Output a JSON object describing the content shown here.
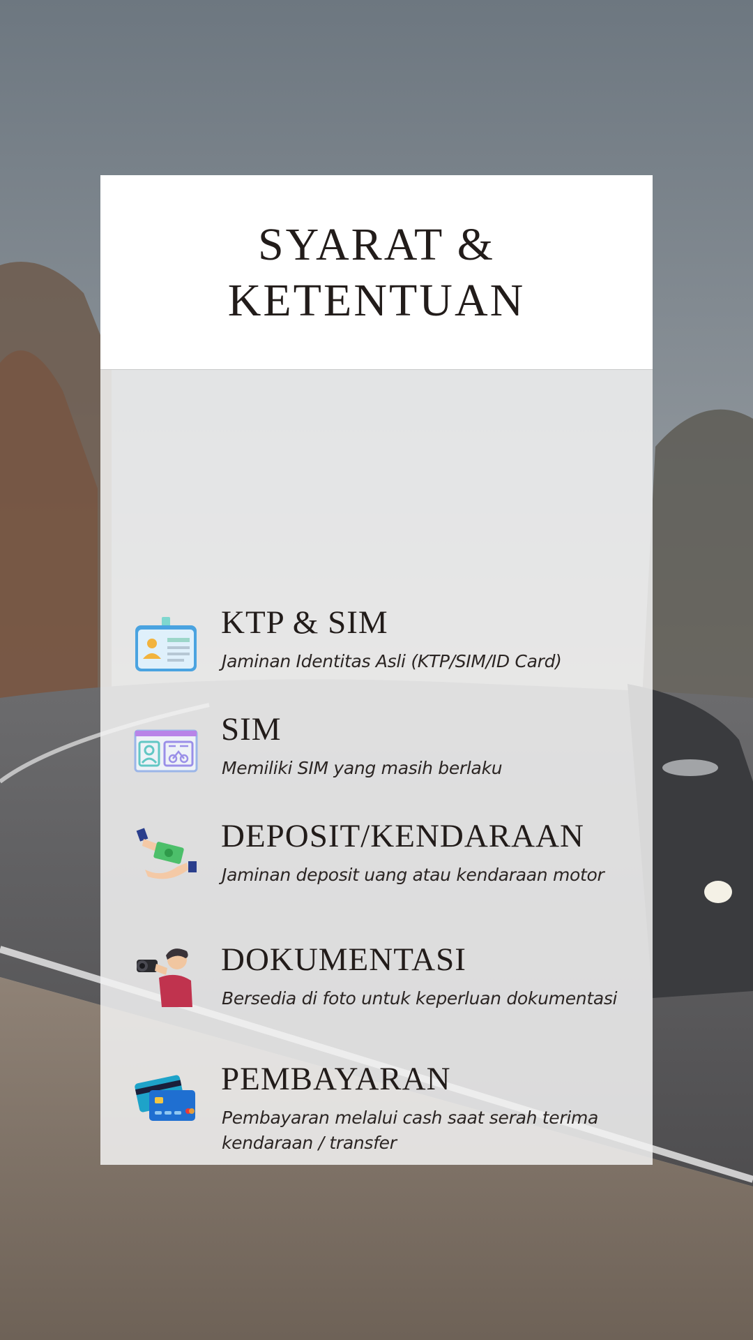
{
  "title_lines": [
    "SYARAT &",
    "KETENTUAN"
  ],
  "items": [
    {
      "icon": "id-card-icon",
      "heading": "KTP & SIM",
      "desc": "Jaminan Identitas Asli (KTP/SIM/ID Card)"
    },
    {
      "icon": "driver-license-icon",
      "heading": "SIM",
      "desc": "Memiliki SIM yang masih berlaku"
    },
    {
      "icon": "money-hand-icon",
      "heading": "DEPOSIT/KENDARAAN",
      "desc": "Jaminan deposit uang atau kendaraan motor"
    },
    {
      "icon": "photographer-icon",
      "heading": "DOKUMENTASI",
      "desc": "Bersedia di foto untuk keperluan dokumentasi"
    },
    {
      "icon": "credit-card-icon",
      "heading": "PEMBAYARAN",
      "desc": "Pembayaran melalui cash saat serah terima kendaraan / transfer"
    }
  ],
  "colors": {
    "text": "#221c1a",
    "card_head": "#ffffff",
    "card_body": "#f2f2f2"
  }
}
